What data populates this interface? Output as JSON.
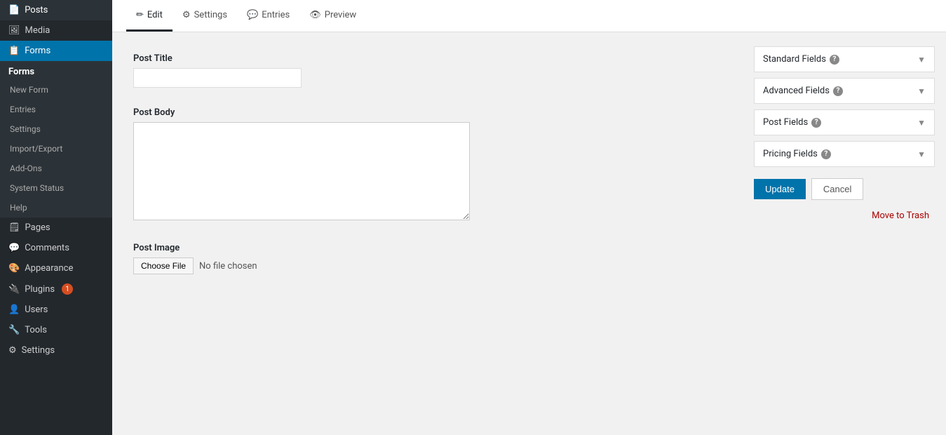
{
  "sidebar": {
    "menu_items": [
      {
        "id": "posts",
        "label": "Posts",
        "icon": "📄"
      },
      {
        "id": "media",
        "label": "Media",
        "icon": "🖼"
      },
      {
        "id": "forms",
        "label": "Forms",
        "icon": "📋",
        "active": true
      },
      {
        "id": "pages",
        "label": "Pages",
        "icon": "🗒"
      },
      {
        "id": "comments",
        "label": "Comments",
        "icon": "💬"
      },
      {
        "id": "appearance",
        "label": "Appearance",
        "icon": "🎨"
      },
      {
        "id": "plugins",
        "label": "Plugins",
        "icon": "🔌",
        "badge": "1"
      },
      {
        "id": "users",
        "label": "Users",
        "icon": "👤"
      },
      {
        "id": "tools",
        "label": "Tools",
        "icon": "🔧"
      },
      {
        "id": "settings",
        "label": "Settings",
        "icon": "⚙"
      }
    ],
    "forms_submenu": [
      {
        "id": "forms-heading",
        "label": "Forms"
      },
      {
        "id": "new-form",
        "label": "New Form"
      },
      {
        "id": "entries",
        "label": "Entries"
      },
      {
        "id": "settings",
        "label": "Settings"
      },
      {
        "id": "import-export",
        "label": "Import/Export"
      },
      {
        "id": "add-ons",
        "label": "Add-Ons"
      },
      {
        "id": "system-status",
        "label": "System Status"
      },
      {
        "id": "help",
        "label": "Help"
      }
    ]
  },
  "header": {
    "tabs": [
      {
        "id": "edit",
        "label": "Edit",
        "icon": "✏",
        "active": true
      },
      {
        "id": "settings",
        "label": "Settings",
        "icon": "⚙"
      },
      {
        "id": "entries",
        "label": "Entries",
        "icon": "💬"
      },
      {
        "id": "preview",
        "label": "Preview",
        "icon": "👁"
      }
    ]
  },
  "form": {
    "post_title_label": "Post Title",
    "post_title_value": "",
    "post_body_label": "Post Body",
    "post_body_value": "",
    "post_image_label": "Post Image",
    "choose_file_label": "Choose File",
    "no_file_text": "No file chosen"
  },
  "right_sidebar": {
    "accordions": [
      {
        "id": "standard-fields",
        "label": "Standard Fields"
      },
      {
        "id": "advanced-fields",
        "label": "Advanced Fields"
      },
      {
        "id": "post-fields",
        "label": "Post Fields"
      },
      {
        "id": "pricing-fields",
        "label": "Pricing Fields"
      }
    ],
    "actions": {
      "update_label": "Update",
      "cancel_label": "Cancel",
      "trash_label": "Move to Trash"
    }
  }
}
